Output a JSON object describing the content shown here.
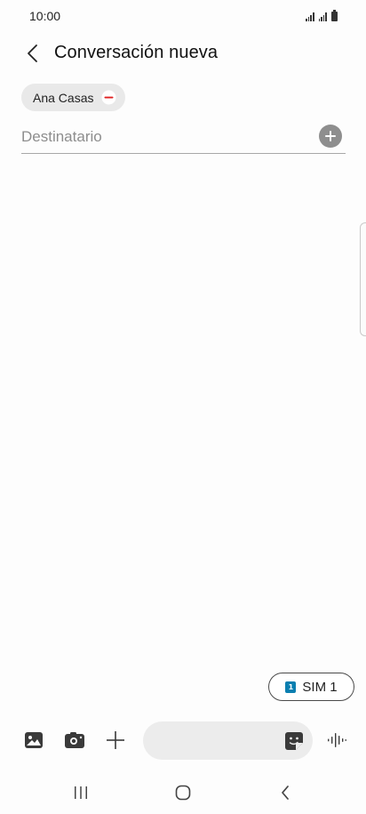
{
  "status_bar": {
    "time": "10:00"
  },
  "header": {
    "title": "Conversación nueva"
  },
  "recipients": {
    "chips": [
      {
        "label": "Ana Casas"
      }
    ],
    "input": {
      "placeholder": "Destinatario",
      "value": ""
    }
  },
  "sim": {
    "badge": "1",
    "label": "SIM 1",
    "accent_color": "#0b7fb0"
  },
  "composer": {
    "message_value": "",
    "icons": [
      "gallery-icon",
      "camera-icon",
      "plus-icon",
      "sticker-icon",
      "voice-recorder-icon"
    ]
  },
  "nav_bar": {
    "icons": [
      "recent-apps-icon",
      "home-icon",
      "back-icon"
    ]
  },
  "colors": {
    "remove_chip": "#e02020",
    "add_contact": "#8e8e8e"
  }
}
